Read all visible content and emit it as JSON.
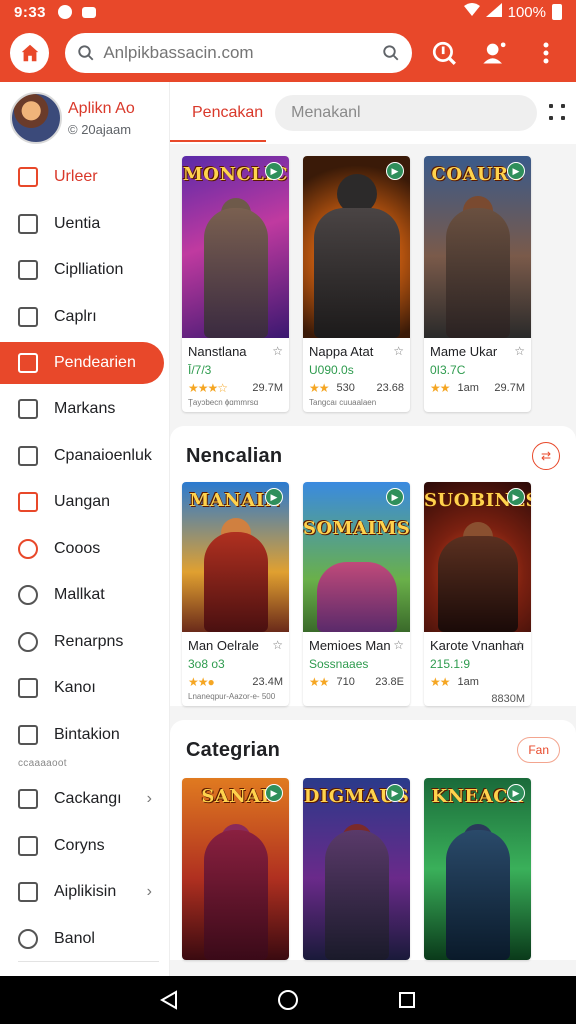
{
  "status": {
    "time": "9:33",
    "battery": "100%"
  },
  "appbar": {
    "search_placeholder": "Anlpikbassacin.com"
  },
  "sidebar": {
    "profile": {
      "name": "Aplikn Ao",
      "subtitle": "© 20ajaam"
    },
    "items": [
      {
        "label": "Urleer"
      },
      {
        "label": "Uentia"
      },
      {
        "label": "Ciplliation"
      },
      {
        "label": "Caplrı"
      },
      {
        "label": "Pendearien"
      },
      {
        "label": "Markans"
      },
      {
        "label": "Cpanaioenluk"
      },
      {
        "label": "Uangan"
      },
      {
        "label": "Cooos"
      },
      {
        "label": "Mallkat"
      },
      {
        "label": "Renarpns"
      },
      {
        "label": "Kanoı"
      },
      {
        "label": "Bintakion"
      }
    ],
    "separator": "ccaaaaoot",
    "items2": [
      {
        "label": "Cackangı"
      },
      {
        "label": "Coryns"
      },
      {
        "label": "Aiplikisin"
      },
      {
        "label": "Banol"
      }
    ]
  },
  "main": {
    "tab_active": "Pencakan",
    "tab_input_value": "Menakanl",
    "featured": [
      {
        "cover_title": "MONCLIC",
        "name": "Nanstlana",
        "sub": "Ī/7/3",
        "rating": "★★★☆",
        "size": "29.7M",
        "small": "Ţayɔbecn ɸɑmmrsɑ"
      },
      {
        "cover_title": "",
        "name": "Nappa  Atat",
        "sub": "U090.0s",
        "rating": "★★",
        "rating_val": "530",
        "size": "23.68",
        "small": "Tangcaı cuuaalaen"
      },
      {
        "cover_title": "COAURC",
        "name": "Mame Ukar",
        "sub": "0I3.7C",
        "rating": "★★",
        "rating_val": "1am",
        "size": "29.7M",
        "small": ""
      }
    ],
    "section1": {
      "title": "Nencalian",
      "cards": [
        {
          "cover_title": "MANAIN",
          "name": "Man Oelrale",
          "sub": "3o8 o3",
          "rating": "★★●",
          "rating_val": "",
          "size": "23.4M",
          "small": "Lnaneqpur-Aazor-e-  500"
        },
        {
          "cover_title": "SOMAIMS",
          "name": "Memioes Man",
          "sub": "Sossnaaes",
          "rating": "★★",
          "rating_val": "710",
          "size": "23.8E",
          "small": ""
        },
        {
          "cover_title": "SUOBINES",
          "name": "Karote Vnanhan",
          "sub": "215.1:9",
          "rating": "★★",
          "rating_val": "1am",
          "size": "",
          "small": ""
        }
      ],
      "extra": "8830M"
    },
    "section2": {
      "title": "Categrian",
      "button": "Fan",
      "cards": [
        {
          "cover_title": "SANAI"
        },
        {
          "cover_title": "DIGMAUS"
        },
        {
          "cover_title": "KNEACR"
        }
      ]
    }
  },
  "colors": {
    "accent": "#e8482a",
    "green": "#2e9b4e",
    "star": "#f5a623"
  }
}
